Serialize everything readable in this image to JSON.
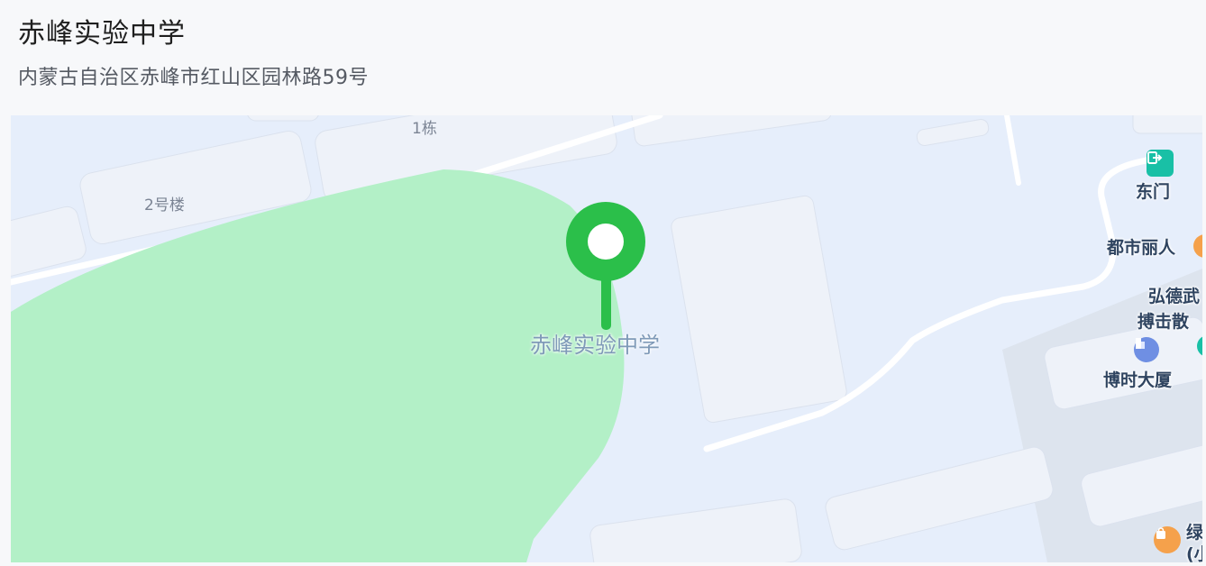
{
  "place": {
    "name": "赤峰实验中学",
    "address": "内蒙古自治区赤峰市红山区园林路59号"
  },
  "map": {
    "marker_label": "赤峰实验中学",
    "building_labels": {
      "building_1": "1栋",
      "building_2": "2号楼"
    },
    "pois": {
      "east_gate": "东门",
      "dushi_liren": "都市丽人",
      "hongde_line1": "弘德武",
      "hongde_line2": "搏击散",
      "boshi_tower": "博时大厦",
      "cut_line1": "绿",
      "cut_line2": "(小"
    },
    "colors": {
      "background": "#e6eefb",
      "green_area": "#b3f0c7",
      "marker": "#2bbf4a",
      "gate_icon": "#19c0a6",
      "shop_icon": "#f5a14b",
      "tower_icon": "#6f8fe3"
    }
  }
}
